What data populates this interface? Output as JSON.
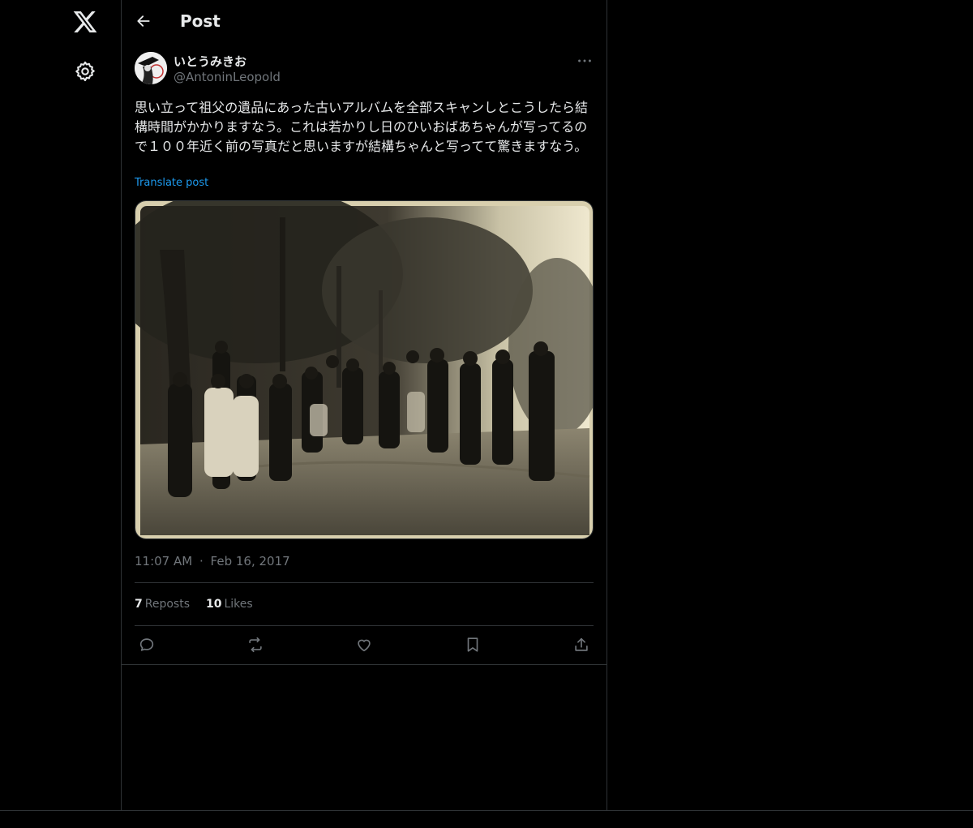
{
  "header": {
    "title": "Post"
  },
  "post": {
    "author": {
      "display_name": "いとうみきお",
      "handle": "@AntoninLeopold"
    },
    "text": "思い立って祖父の遺品にあった古いアルバムを全部スキャンしとこうしたら結構時間がかかりますなう。これは若かりし日のひいおばあちゃんが写ってるので１００年近く前の写真だと思いますが結構ちゃんと写ってて驚きますなう。",
    "translate_label": "Translate post",
    "time": "11:07 AM",
    "separator": "·",
    "date": "Feb 16, 2017",
    "reposts": {
      "count": "7",
      "label": "Reposts"
    },
    "likes": {
      "count": "10",
      "label": "Likes"
    }
  },
  "icons": {
    "logo": "x-logo-icon",
    "settings": "gear-icon",
    "back": "arrow-left-icon",
    "more": "more-horizontal-icon",
    "reply": "speech-bubble-icon",
    "repost": "repost-icon",
    "like": "heart-icon",
    "bookmark": "bookmark-icon",
    "share": "share-icon"
  },
  "colors": {
    "background": "#000000",
    "text": "#e7e9ea",
    "muted": "#71767b",
    "accent": "#1d9bf0",
    "border": "#2f3336"
  }
}
